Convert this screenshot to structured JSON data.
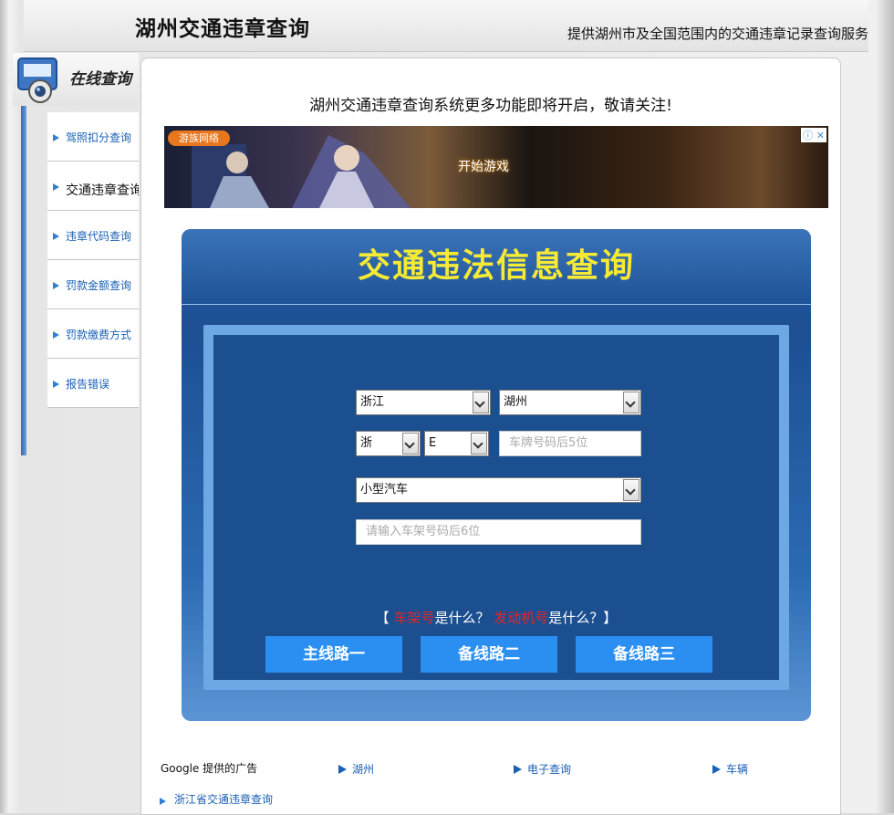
{
  "header": {
    "title": "湖州交通违章查询",
    "description": "提供湖州市及全国范围内的交通违章记录查询服务"
  },
  "sidebar": {
    "heading": "在线查询",
    "items": [
      {
        "label": "驾照扣分查询"
      },
      {
        "label": "交通违章查询"
      },
      {
        "label": "违章代码查询"
      },
      {
        "label": "罚款金额查询"
      },
      {
        "label": "罚款缴费方式"
      },
      {
        "label": "报告错误"
      }
    ]
  },
  "main": {
    "notice": "湖州交通违章查询系统更多功能即将开启，敬请关注!",
    "ad_banner": {
      "logo_text": "游族网络",
      "cta": "开始游戏",
      "ad_marker": "ⓘ ✕"
    },
    "form": {
      "title": "交通违法信息查询",
      "province_select": "浙江",
      "city_select": "湖州",
      "plate_prefix_select": "浙",
      "plate_letter_select": "E",
      "plate_input_placeholder": "车牌号码后5位",
      "vehicle_type_select": "小型汽车",
      "frame_input_placeholder": "请输入车架号码后6位",
      "help_prefix": "【",
      "help_frame_link": "车架号",
      "help_mid": "是什么？",
      "help_engine_link": "发动机号",
      "help_suffix": "是什么？】",
      "buttons": {
        "primary": "主线路一",
        "backup2": "备线路二",
        "backup3": "备线路三"
      }
    },
    "ad_links": {
      "label": "Google 提供的广告",
      "links": [
        "湖州",
        "电子查询",
        "车辆"
      ]
    },
    "bottom_link": "浙江省交通违章查询"
  }
}
